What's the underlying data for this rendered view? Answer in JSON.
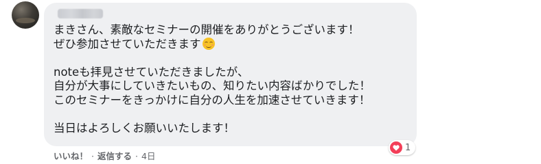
{
  "comment": {
    "lines": [
      "まきさん、素敵なセミナーの開催をありがとうございます！",
      "ぜひ参加させていただきます",
      "noteも拝見させていただきましたが、",
      "自分が大事にしていきたいもの、知りたい内容ばかりでした！",
      "このセミナーをきっかけに自分の人生を加速させていきます！",
      "当日はよろしくお願いいたします！"
    ],
    "emoji": "smiling-face-emoji"
  },
  "actions": {
    "like_label": "いいね！",
    "separator": "·",
    "reply_label": "返信する",
    "time": "4日"
  },
  "reaction": {
    "icon": "heart-icon",
    "count": "1",
    "color": "#f33e58"
  },
  "colors": {
    "bubble": "#eff0f2",
    "text": "#1c1e21",
    "meta": "#65676b"
  }
}
